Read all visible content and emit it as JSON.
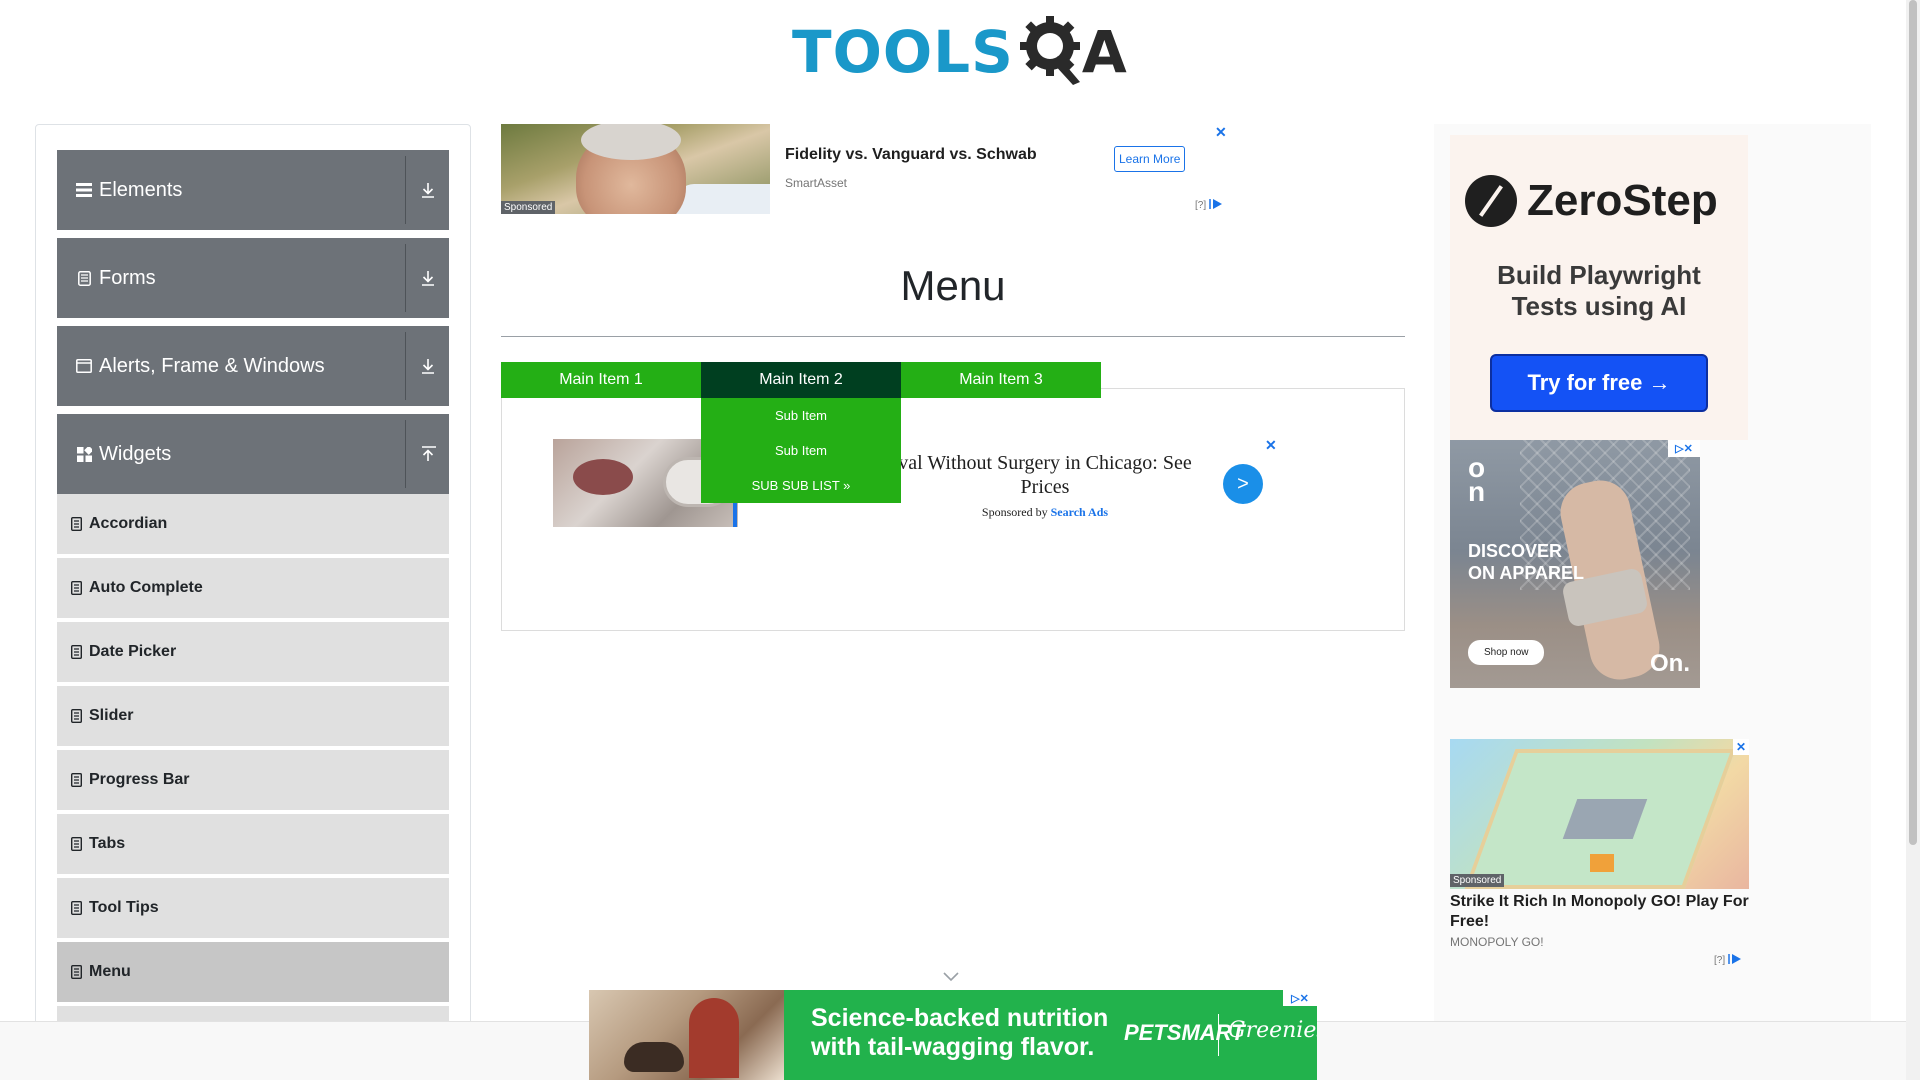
{
  "header": {
    "logo_main": "TOOLS",
    "logo_q": "Q",
    "logo_a": "A"
  },
  "sidebar": {
    "groups": [
      {
        "label": "Elements",
        "icon": "hamburger-icon",
        "arrow": "download-arrow-icon"
      },
      {
        "label": "Forms",
        "icon": "form-icon",
        "arrow": "download-arrow-icon"
      },
      {
        "label": "Alerts, Frame & Windows",
        "icon": "window-icon",
        "arrow": "download-arrow-icon"
      },
      {
        "label": "Widgets",
        "icon": "widgets-icon",
        "arrow": "upload-arrow-icon"
      }
    ],
    "widgets_items": [
      {
        "label": "Accordian"
      },
      {
        "label": "Auto Complete"
      },
      {
        "label": "Date Picker"
      },
      {
        "label": "Slider"
      },
      {
        "label": "Progress Bar"
      },
      {
        "label": "Tabs"
      },
      {
        "label": "Tool Tips"
      },
      {
        "label": "Menu",
        "active": true
      }
    ]
  },
  "ad_top": {
    "sponsored": "Sponsored",
    "title": "Fidelity vs. Vanguard vs. Schwab",
    "source": "SmartAsset",
    "button": "Learn More",
    "close": "✕",
    "info": "[?]"
  },
  "main": {
    "title": "Menu",
    "nav": [
      {
        "label": "Main Item 1"
      },
      {
        "label": "Main Item 2",
        "hover": true
      },
      {
        "label": "Main Item 3"
      }
    ],
    "submenu": [
      "Sub Item",
      "Sub Item",
      "SUB SUB LIST »"
    ]
  },
  "ad_mid": {
    "title": "…val Without Surgery in Chicago: See Prices",
    "title_visible": "val Without Surgery in Chicago: See Prices",
    "sponsor_prefix": "Sponsored by ",
    "sponsor_name": "Search Ads",
    "go": ">",
    "close": "✕"
  },
  "right": {
    "zerostep": {
      "name": "ZeroStep",
      "tagline_1": "Build Playwright",
      "tagline_2": "Tests using AI",
      "button": "Try for free →"
    },
    "on_ad": {
      "mark": "O\nn",
      "text_1": "DISCOVER",
      "text_2": "ON APPAREL",
      "shop": "Shop now",
      "logo": "On.",
      "adchoice": "▷✕"
    },
    "mono_ad": {
      "sponsored": "Sponsored",
      "title": "Strike It Rich In Monopoly GO! Play For Free!",
      "source": "MONOPOLY GO!",
      "info": "[?]",
      "close": "✕"
    }
  },
  "bottom_ad": {
    "tagline_1": "Science-backed nutrition",
    "tagline_2": "with tail-wagging flavor.",
    "brand_1": "PETSMART",
    "brand_2": "Greenies",
    "adchoice": "▷✕"
  },
  "colors": {
    "menu_green": "#24af15",
    "menu_hover": "#003f20",
    "sidebar_group": "#6d7278",
    "sidebar_item": "#e0e0e0",
    "logo_blue": "#1a98c9"
  }
}
